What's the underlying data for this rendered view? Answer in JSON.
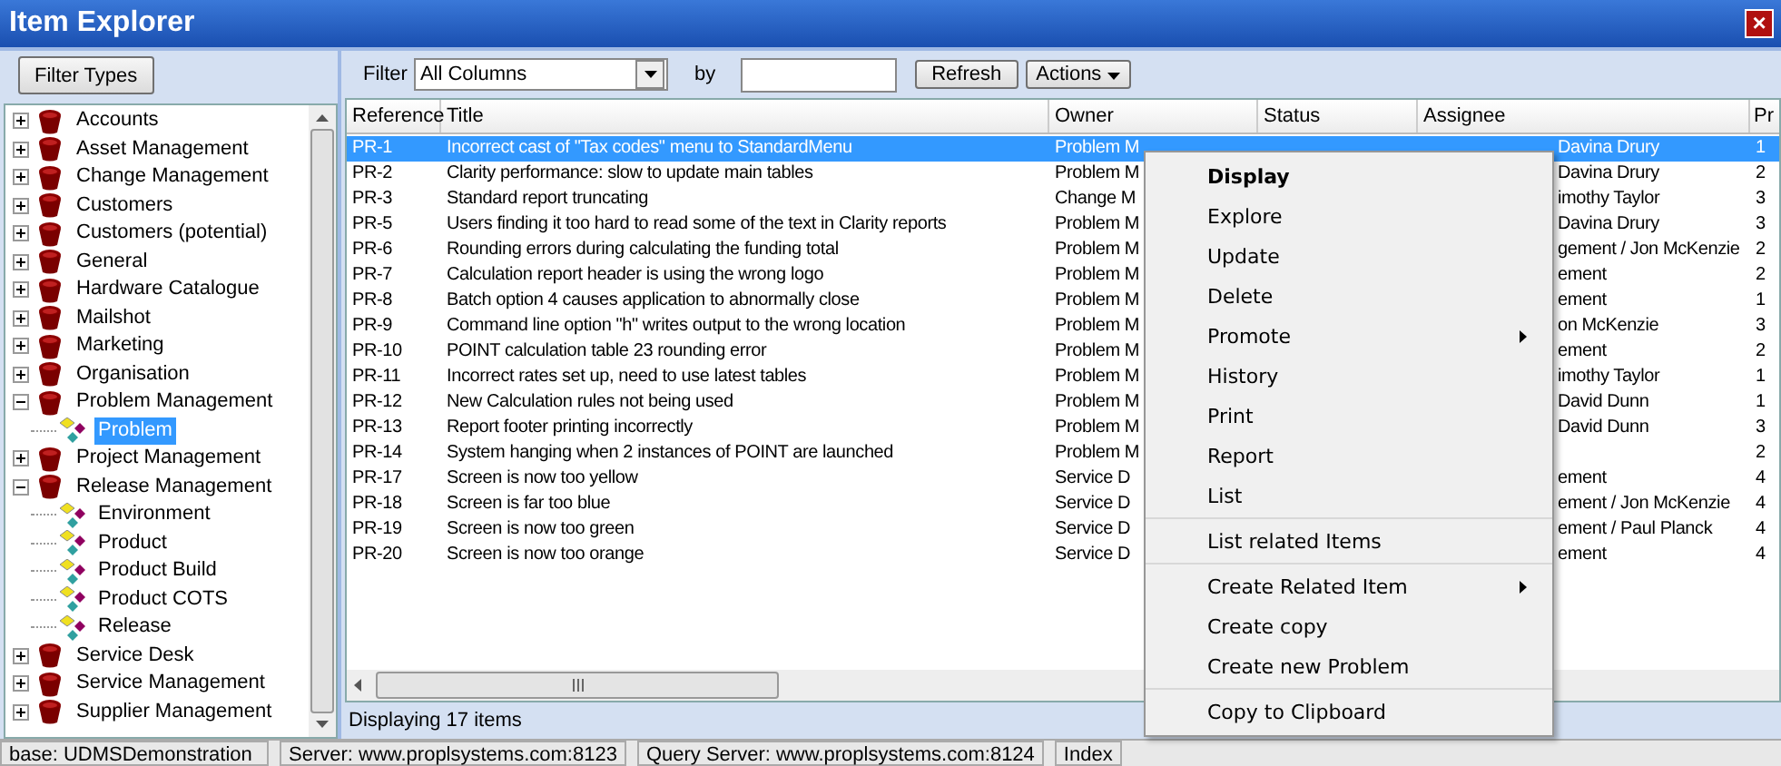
{
  "window": {
    "title": "Item Explorer",
    "close": "×"
  },
  "sidebar": {
    "filter_button": "Filter Types",
    "tree": [
      {
        "label": "Accounts",
        "expanded": false,
        "selected": false
      },
      {
        "label": "Asset Management",
        "expanded": false,
        "selected": false
      },
      {
        "label": "Change Management",
        "expanded": false,
        "selected": false
      },
      {
        "label": "Customers",
        "expanded": false,
        "selected": false
      },
      {
        "label": "Customers (potential)",
        "expanded": false,
        "selected": false
      },
      {
        "label": "General",
        "expanded": false,
        "selected": false
      },
      {
        "label": "Hardware Catalogue",
        "expanded": false,
        "selected": false
      },
      {
        "label": "Mailshot",
        "expanded": false,
        "selected": false
      },
      {
        "label": "Marketing",
        "expanded": false,
        "selected": false
      },
      {
        "label": "Organisation",
        "expanded": false,
        "selected": false
      },
      {
        "label": "Problem Management",
        "expanded": true,
        "selected": false,
        "children": [
          {
            "label": "Problem",
            "selected": true
          }
        ]
      },
      {
        "label": "Project Management",
        "expanded": false,
        "selected": false
      },
      {
        "label": "Release Management",
        "expanded": true,
        "selected": false,
        "children": [
          {
            "label": "Environment",
            "selected": false
          },
          {
            "label": "Product",
            "selected": false
          },
          {
            "label": "Product Build",
            "selected": false
          },
          {
            "label": "Product COTS",
            "selected": false
          },
          {
            "label": "Release",
            "selected": false
          }
        ]
      },
      {
        "label": "Service Desk",
        "expanded": false,
        "selected": false
      },
      {
        "label": "Service Management",
        "expanded": false,
        "selected": false
      },
      {
        "label": "Supplier Management",
        "expanded": false,
        "selected": false
      }
    ]
  },
  "toolbar": {
    "filter_label": "Filter",
    "filter_value": "All Columns",
    "by_label": "by",
    "refresh": "Refresh",
    "actions": "Actions"
  },
  "table": {
    "columns": [
      "Reference",
      "Title",
      "Owner",
      "Status",
      "Assignee",
      "Pr"
    ],
    "rows": [
      {
        "reference": "PR-1",
        "title": "Incorrect cast of \"Tax codes\" menu to StandardMenu",
        "owner": "Problem M",
        "assignee": "Davina Drury",
        "priority": "1",
        "selected": true
      },
      {
        "reference": "PR-2",
        "title": "Clarity performance: slow to update main tables",
        "owner": "Problem M",
        "assignee": "Davina Drury",
        "priority": "2",
        "selected": false
      },
      {
        "reference": "PR-3",
        "title": "Standard report truncating",
        "owner": "Change M",
        "assignee": "imothy Taylor",
        "priority": "3",
        "selected": false
      },
      {
        "reference": "PR-5",
        "title": "Users finding it too hard to read some of the text in Clarity reports",
        "owner": "Problem M",
        "assignee": "Davina Drury",
        "priority": "3",
        "selected": false
      },
      {
        "reference": "PR-6",
        "title": "Rounding errors during calculating the funding total",
        "owner": "Problem M",
        "assignee": "gement / Jon McKenzie",
        "priority": "2",
        "selected": false
      },
      {
        "reference": "PR-7",
        "title": "Calculation report header is using the wrong logo",
        "owner": "Problem M",
        "assignee": "ement",
        "priority": "2",
        "selected": false
      },
      {
        "reference": "PR-8",
        "title": "Batch option 4 causes application to abnormally close",
        "owner": "Problem M",
        "assignee": "ement",
        "priority": "1",
        "selected": false
      },
      {
        "reference": "PR-9",
        "title": "Command line option \"h\" writes output to the wrong location",
        "owner": "Problem M",
        "assignee": "on McKenzie",
        "priority": "3",
        "selected": false
      },
      {
        "reference": "PR-10",
        "title": "POINT calculation table 23 rounding error",
        "owner": "Problem M",
        "assignee": "ement",
        "priority": "2",
        "selected": false
      },
      {
        "reference": "PR-11",
        "title": "Incorrect rates set up, need to use latest tables",
        "owner": "Problem M",
        "assignee": "imothy Taylor",
        "priority": "1",
        "selected": false
      },
      {
        "reference": "PR-12",
        "title": "New Calculation rules not being used",
        "owner": "Problem M",
        "assignee": "David Dunn",
        "priority": "1",
        "selected": false
      },
      {
        "reference": "PR-13",
        "title": "Report footer printing incorrectly",
        "owner": "Problem M",
        "assignee": "David Dunn",
        "priority": "3",
        "selected": false
      },
      {
        "reference": "PR-14",
        "title": "System hanging when 2 instances of POINT are launched",
        "owner": "Problem M",
        "priority": "2",
        "selected": false
      },
      {
        "reference": "PR-17",
        "title": "Screen is now too yellow",
        "owner": "Service D",
        "assignee": "ement",
        "priority": "4",
        "selected": false
      },
      {
        "reference": "PR-18",
        "title": "Screen is far too blue",
        "owner": "Service D",
        "assignee": "ement / Jon McKenzie",
        "priority": "4",
        "selected": false
      },
      {
        "reference": "PR-19",
        "title": "Screen is now too green",
        "owner": "Service D",
        "assignee": "ement / Paul Planck",
        "priority": "4",
        "selected": false
      },
      {
        "reference": "PR-20",
        "title": "Screen is now too orange",
        "owner": "Service D",
        "assignee": "ement",
        "priority": "4",
        "selected": false
      }
    ],
    "footer": "Displaying 17 items"
  },
  "context_menu": {
    "groups": [
      [
        {
          "label": "Display",
          "default": true,
          "submenu": false
        },
        {
          "label": "Explore",
          "default": false,
          "submenu": false
        },
        {
          "label": "Update",
          "default": false,
          "submenu": false
        },
        {
          "label": "Delete",
          "default": false,
          "submenu": false
        },
        {
          "label": "Promote",
          "default": false,
          "submenu": true
        },
        {
          "label": "History",
          "default": false,
          "submenu": false
        },
        {
          "label": "Print",
          "default": false,
          "submenu": false
        },
        {
          "label": "Report",
          "default": false,
          "submenu": false
        },
        {
          "label": "List",
          "default": false,
          "submenu": false
        }
      ],
      [
        {
          "label": "List related Items",
          "default": false,
          "submenu": false
        }
      ],
      [
        {
          "label": "Create Related Item",
          "default": false,
          "submenu": true
        },
        {
          "label": "Create copy",
          "default": false,
          "submenu": false
        },
        {
          "label": "Create new Problem",
          "default": false,
          "submenu": false
        }
      ],
      [
        {
          "label": "Copy to Clipboard",
          "default": false,
          "submenu": false
        }
      ]
    ]
  },
  "status_bar": [
    "base: UDMSDemonstration",
    "Server: www.proplsystems.com:8123",
    "Query Server: www.proplsystems.com:8124",
    "Index"
  ]
}
